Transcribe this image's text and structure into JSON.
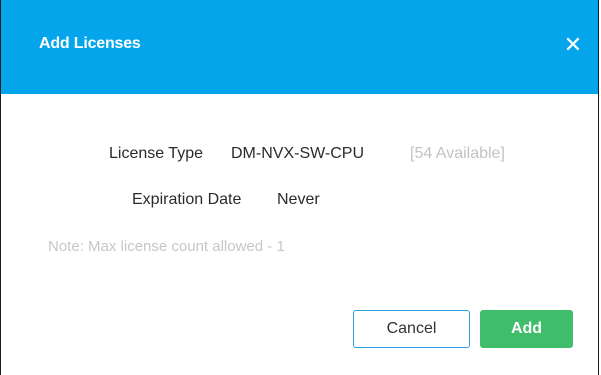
{
  "dialog": {
    "title": "Add Licenses",
    "close_icon": "close-icon",
    "close_glyph": "✕"
  },
  "license_type": {
    "label": "License Type",
    "value": "DM-NVX-SW-CPU",
    "availability": "[54 Available]"
  },
  "expiration_date": {
    "label": "Expiration Date",
    "value": "Never"
  },
  "note": "Note: Max license count allowed - 1",
  "buttons": {
    "cancel_label": "Cancel",
    "add_label": "Add"
  },
  "colors": {
    "header": "#05a5eb",
    "add_button": "#3fbd6a",
    "cancel_border": "#2aa3e0",
    "muted_text": "#c3c3c3"
  }
}
